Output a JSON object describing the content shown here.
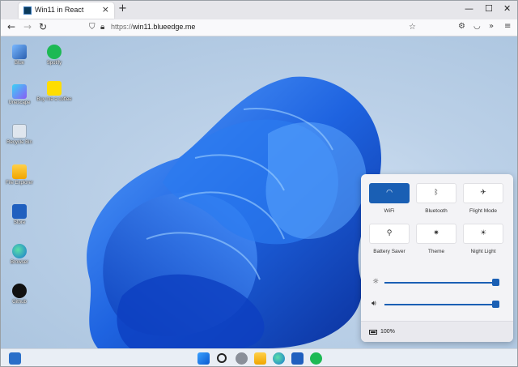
{
  "browser": {
    "tab_title": "Win11 in React",
    "tab_close": "×",
    "new_tab": "+",
    "url_scheme": "https://",
    "url_domain": "win11.blueedge.me",
    "window_minimize": "—",
    "window_maximize": "☐",
    "window_close": "✕"
  },
  "desktop": {
    "icons": [
      {
        "label": "Blue",
        "icon": "blue-computer-icon"
      },
      {
        "label": "Spotify",
        "icon": "spotify-icon"
      },
      {
        "label": "Unescape",
        "icon": "unescape-icon"
      },
      {
        "label": "Buy me a coffee",
        "icon": "coffee-icon"
      },
      {
        "label": "Recycle Bin",
        "icon": "recycle-bin-icon"
      },
      {
        "label": "File Explorer",
        "icon": "folder-icon"
      },
      {
        "label": "Store",
        "icon": "store-icon"
      },
      {
        "label": "Browser",
        "icon": "edge-icon"
      },
      {
        "label": "Github",
        "icon": "github-icon"
      }
    ]
  },
  "quick_settings": {
    "tiles": [
      {
        "label": "WiFi",
        "icon": "wifi-icon",
        "active": true
      },
      {
        "label": "Bluetooth",
        "icon": "bluetooth-icon",
        "active": false
      },
      {
        "label": "Flight Mode",
        "icon": "airplane-icon",
        "active": false
      },
      {
        "label": "Battery Saver",
        "icon": "battery-saver-icon",
        "active": false
      },
      {
        "label": "Theme",
        "icon": "theme-icon",
        "active": false
      },
      {
        "label": "Night Light",
        "icon": "night-light-icon",
        "active": false
      }
    ],
    "brightness": 1.0,
    "volume": 1.0,
    "battery": "100%"
  },
  "taskbar": {
    "items": [
      "widgets-icon",
      "start-icon",
      "search-icon",
      "settings-icon",
      "file-explorer-icon",
      "edge-icon",
      "store-icon",
      "spotify-icon"
    ]
  },
  "colors": {
    "accent": "#1a5fb4",
    "bloom": "#1f6fe6"
  }
}
